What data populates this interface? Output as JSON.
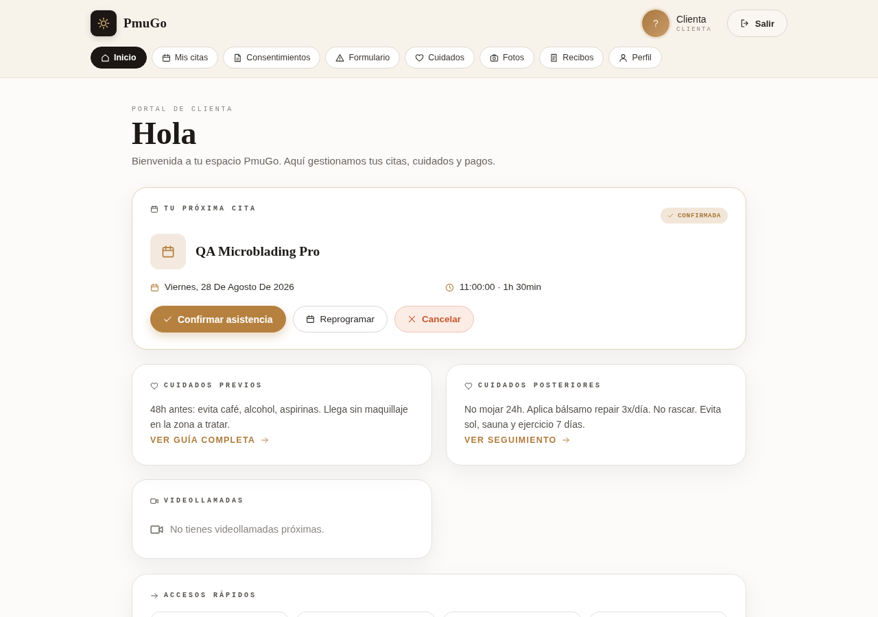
{
  "header": {
    "brand": "PmuGo",
    "user": {
      "avatar_initial": "?",
      "name": "Clienta",
      "role": "CLIENTA"
    },
    "logout_button": "Salir"
  },
  "nav": [
    {
      "label": "Inicio",
      "selected": true
    },
    {
      "label": "Mis citas",
      "selected": false
    },
    {
      "label": "Consentimientos",
      "selected": false
    },
    {
      "label": "Formulario",
      "selected": false
    },
    {
      "label": "Cuidados",
      "selected": false
    },
    {
      "label": "Fotos",
      "selected": false
    },
    {
      "label": "Recibos",
      "selected": false
    },
    {
      "label": "Perfil",
      "selected": false
    }
  ],
  "hero": {
    "eyebrow": "PORTAL DE CLIENTA",
    "title": "Hola",
    "subtitle": "Bienvenida a tu espacio PmuGo. Aquí gestionamos tus citas, cuidados y pagos."
  },
  "next_appointment": {
    "label": "TU PRÓXIMA CITA",
    "status": "CONFIRMADA",
    "service": "QA Microblading Pro",
    "date": "Viernes, 28 De Agosto De 2026",
    "time": "11:00:00 · 1h 30min",
    "actions": [
      {
        "label": "Confirmar asistencia",
        "kind": "primary"
      },
      {
        "label": "Reprogramar",
        "kind": "secondary"
      },
      {
        "label": "Cancelar",
        "kind": "danger"
      }
    ]
  },
  "care_cards": [
    {
      "title": "CUIDADOS PREVIOS",
      "text": "48h antes: evita café, alcohol, aspirinas. Llega sin maquillaje en la zona a tratar.",
      "link": "VER GUÍA COMPLETA"
    },
    {
      "title": "CUIDADOS POSTERIORES",
      "text": "No mojar 24h. Aplica bálsamo repair 3x/día. No rascar. Evita sol, sauna y ejercicio 7 días.",
      "link": "VER SEGUIMIENTO"
    }
  ],
  "video_calls": {
    "title": "VIDEOLLAMADAS",
    "empty_text": "No tienes videollamadas próximas."
  },
  "quick_access": {
    "title": "ACCESOS RÁPIDOS"
  }
}
